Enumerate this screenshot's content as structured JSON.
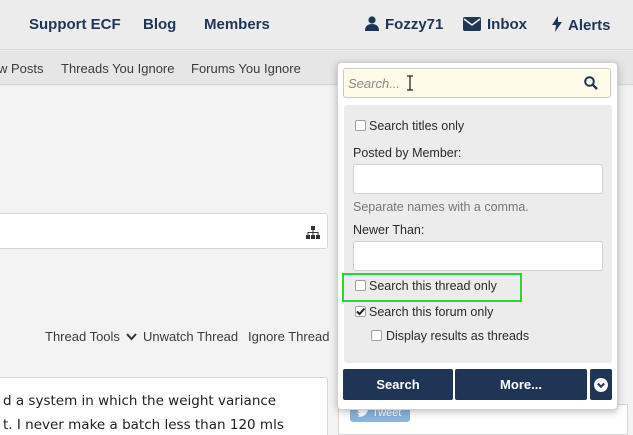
{
  "topnav": {
    "support": "Support ECF",
    "blog": "Blog",
    "members": "Members",
    "user": "Fozzy71",
    "inbox": "Inbox",
    "alerts": "Alerts"
  },
  "subnav": {
    "new_posts": "w Posts",
    "threads_ignore": "Threads You Ignore",
    "forums_ignore": "Forums You Ignore"
  },
  "thread_tools": {
    "tools": "Thread Tools",
    "unwatch": "Unwatch Thread",
    "ignore": "Ignore Thread"
  },
  "post": {
    "line1": "d a system in which the weight variance",
    "line2": "t. I never make a batch less than 120 mls"
  },
  "tweet": "Tweet",
  "search": {
    "placeholder": "Search...",
    "titles_only": "Search titles only",
    "posted_by_label": "Posted by Member:",
    "posted_by_value": "",
    "posted_by_hint": "Separate names with a comma.",
    "newer_than_label": "Newer Than:",
    "newer_than_value": "",
    "this_thread": "Search this thread only",
    "this_forum": "Search this forum only",
    "display_threads": "Display results as threads",
    "search_button": "Search",
    "more_button": "More...",
    "checked": {
      "titles_only": false,
      "this_thread": false,
      "this_forum": true,
      "display_threads": false
    }
  },
  "colors": {
    "nav_text": "#1f3556",
    "button_bg": "#1f3556",
    "highlight": "#2fd52f",
    "search_bg": "#fefce9"
  }
}
